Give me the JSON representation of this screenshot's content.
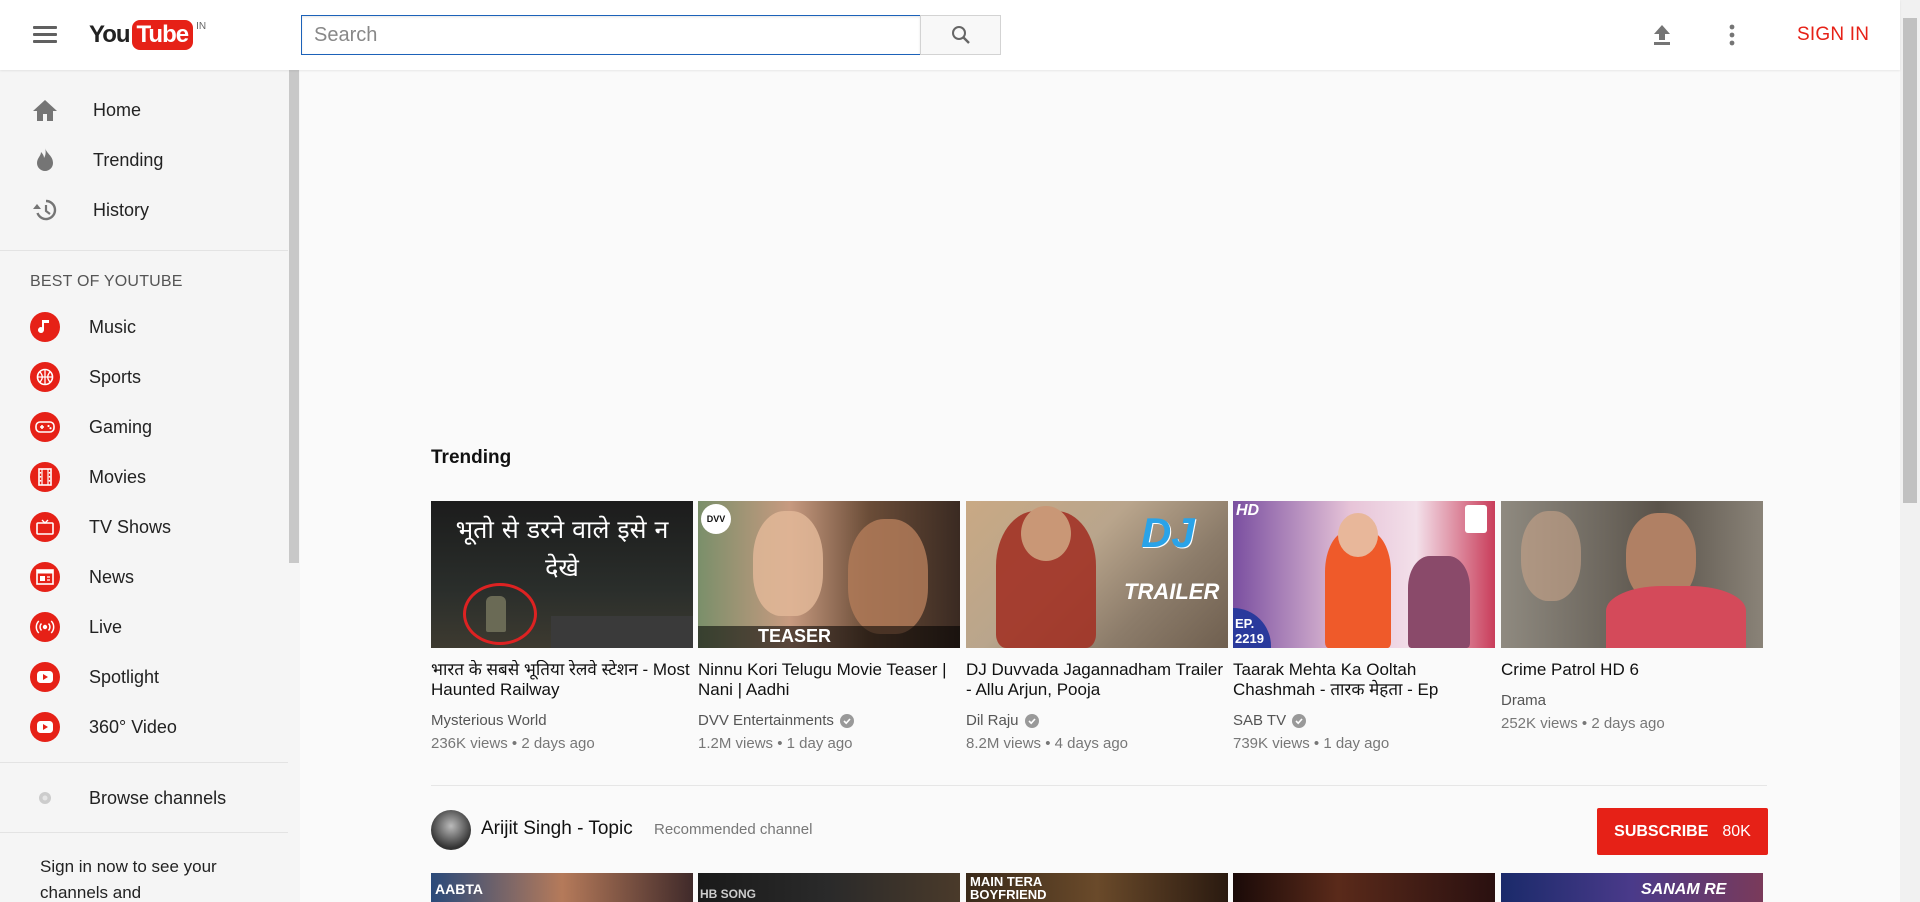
{
  "header": {
    "logo_you": "You",
    "logo_tube": "Tube",
    "logo_country": "IN",
    "search_placeholder": "Search",
    "sign_in": "SIGN IN"
  },
  "sidebar": {
    "main_items": [
      {
        "label": "Home",
        "icon": "home-icon"
      },
      {
        "label": "Trending",
        "icon": "flame-icon"
      },
      {
        "label": "History",
        "icon": "history-icon"
      }
    ],
    "best_of_heading": "BEST OF YOUTUBE",
    "categories": [
      {
        "label": "Music",
        "icon": "music-icon"
      },
      {
        "label": "Sports",
        "icon": "sports-icon"
      },
      {
        "label": "Gaming",
        "icon": "gamepad-icon"
      },
      {
        "label": "Movies",
        "icon": "film-icon"
      },
      {
        "label": "TV Shows",
        "icon": "tv-icon"
      },
      {
        "label": "News",
        "icon": "news-icon"
      },
      {
        "label": "Live",
        "icon": "live-icon"
      },
      {
        "label": "Spotlight",
        "icon": "spotlight-icon"
      },
      {
        "label": "360° Video",
        "icon": "360-video-icon"
      }
    ],
    "browse_channels": "Browse channels",
    "signin_message": "Sign in now to see your channels and"
  },
  "trending": {
    "title": "Trending",
    "videos": [
      {
        "title": "भारत के सबसे भूतिया रेलवे स्टेशन - Most Haunted Railway",
        "channel": "Mysterious World",
        "verified": false,
        "views": "236K views",
        "age": "2 days ago",
        "thumb_text": "भूतो से डरने वाले इसे न देखे"
      },
      {
        "title": "Ninnu Kori Telugu Movie Teaser | Nani | Aadhi",
        "channel": "DVV Entertainments",
        "verified": true,
        "views": "1.2M views",
        "age": "1 day ago",
        "thumb_text": "TEASER",
        "thumb_badge": "DVV"
      },
      {
        "title": "DJ Duvvada Jagannadham Trailer - Allu Arjun, Pooja",
        "channel": "Dil Raju",
        "verified": true,
        "views": "8.2M views",
        "age": "4 days ago",
        "thumb_text": "TRAILER",
        "thumb_badge": "DJ"
      },
      {
        "title": "Taarak Mehta Ka Ooltah Chashmah - तारक मेहता - Ep",
        "channel": "SAB TV",
        "verified": true,
        "views": "739K views",
        "age": "1 day ago",
        "thumb_text": "EP. 2219",
        "thumb_badge": "HD"
      },
      {
        "title": "Crime Patrol HD 6",
        "channel": "Drama",
        "verified": false,
        "views": "252K views",
        "age": "2 days ago"
      }
    ]
  },
  "recommended_channel": {
    "name": "Arijit Singh - Topic",
    "label": "Recommended channel",
    "subscribe_label": "SUBSCRIBE",
    "subscriber_count": "80K"
  },
  "row2_thumbs": [
    {
      "text": "AABTA"
    },
    {
      "text": "HB SONG"
    },
    {
      "text": "MAIN TERA BOYFRIEND"
    },
    {
      "text": ""
    },
    {
      "text": "SANAM RE"
    }
  ],
  "colors": {
    "brand_red": "#e62117",
    "search_border": "#1c62b9"
  }
}
